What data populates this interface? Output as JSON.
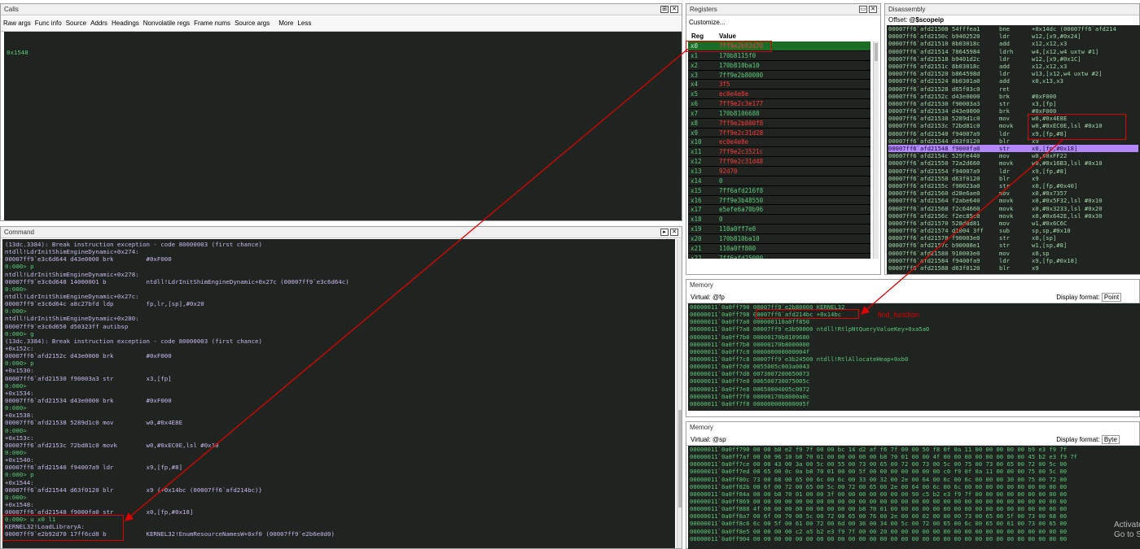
{
  "calls": {
    "title": "Calls",
    "toolbar": [
      "Raw args",
      "Func info",
      "Source",
      "Addrs",
      "Headings",
      "Nonvolatile regs",
      "Frame nums",
      "Source args",
      "More",
      "Less"
    ],
    "content": "0x1548"
  },
  "command": {
    "title": "Command",
    "lines": [
      {
        "t": "(13dc.3384): Break instruction exception - code 80000003 (first chance)",
        "c": "c-lav"
      },
      {
        "t": "ntdll!LdrInitShimEngineDynamic+0x274:",
        "c": "c-lav"
      },
      {
        "t": "00007ff9`e3c6d644 d43e0000 brk         #0xF000",
        "c": "c-lav"
      },
      {
        "t": "0:000> p",
        "c": "c-grn"
      },
      {
        "t": "ntdll!LdrInitShimEngineDynamic+0x278:",
        "c": "c-lav"
      },
      {
        "t": "00007ff9`e3c6d648 14000001 b           ntdll!LdrInitShimEngineDynamic+0x27c (00007ff9`e3c6d64c)",
        "c": "c-lav"
      },
      {
        "t": "0:000>",
        "c": "c-grn"
      },
      {
        "t": "ntdll!LdrInitShimEngineDynamic+0x27c:",
        "c": "c-lav"
      },
      {
        "t": "00007ff9`e3c6d64c a8c27bfd ldp         fp,lr,[sp],#0x20",
        "c": "c-lav"
      },
      {
        "t": "0:000>",
        "c": "c-grn"
      },
      {
        "t": "ntdll!LdrInitShimEngineDynamic+0x280:",
        "c": "c-lav"
      },
      {
        "t": "00007ff9`e3c6d650 d50323ff autibsp",
        "c": "c-lav"
      },
      {
        "t": "0:000> g",
        "c": "c-grn"
      },
      {
        "t": "(13dc.3384): Break instruction exception - code 80000003 (first chance)",
        "c": "c-lav"
      },
      {
        "t": "+0x152c:",
        "c": "c-lav"
      },
      {
        "t": "00007ff6`afd2152c d43e0000 brk         #0xF000",
        "c": "c-lav"
      },
      {
        "t": "0:000> p",
        "c": "c-grn"
      },
      {
        "t": "+0x1530:",
        "c": "c-lav"
      },
      {
        "t": "00007ff6`afd21530 f90003a3 str         x3,[fp]",
        "c": "c-lav"
      },
      {
        "t": "0:000>",
        "c": "c-grn"
      },
      {
        "t": "+0x1534:",
        "c": "c-lav"
      },
      {
        "t": "00007ff6`afd21534 d43e0000 brk         #0xF000",
        "c": "c-lav"
      },
      {
        "t": "0:000>",
        "c": "c-grn"
      },
      {
        "t": "+0x1538:",
        "c": "c-lav"
      },
      {
        "t": "00007ff6`afd21538 5289d1c0 mov         w0,#0x4E8E",
        "c": "c-lav"
      },
      {
        "t": "0:000>",
        "c": "c-grn"
      },
      {
        "t": "+0x153c:",
        "c": "c-lav"
      },
      {
        "t": "00007ff6`afd2153c 72bd81c0 movk        w0,#0xEC0E,lsl #0x10",
        "c": "c-lav"
      },
      {
        "t": "0:000>",
        "c": "c-grn"
      },
      {
        "t": "+0x1540:",
        "c": "c-lav"
      },
      {
        "t": "00007ff6`afd21540 f94007a9 ldr         x9,[fp,#8]",
        "c": "c-lav"
      },
      {
        "t": "0:000> p",
        "c": "c-grn"
      },
      {
        "t": "+0x1544:",
        "c": "c-lav"
      },
      {
        "t": "00007ff6`afd21544 d63f0120 blr         x9 {+0x14bc (00007ff6`afd214bc)}",
        "c": "c-lav"
      },
      {
        "t": "0:000>",
        "c": "c-grn"
      },
      {
        "t": "+0x1548:",
        "c": "c-lav"
      },
      {
        "t": "00007ff6`afd21548 f9000fa0 str         x0,[fp,#0x18]",
        "c": "c-lav"
      },
      {
        "t": "0:000> u x0 l1",
        "c": "c-grn"
      },
      {
        "t": "KERNEL32!LoadLibraryA:",
        "c": "c-lav"
      },
      {
        "t": "00007ff9`e2b92d70 17ff6cd8 b           KERNEL32!EnumResourceNamesW+0xf0 (00007ff9`e2b6e0d0)",
        "c": "c-lav"
      }
    ]
  },
  "registers": {
    "title": "Registers",
    "customize": "Customize...",
    "col_reg": "Reg",
    "col_value": "Value",
    "rows": [
      {
        "r": "x0",
        "v": "7ff9e2b92d70",
        "red": true
      },
      {
        "r": "x1",
        "v": "170b8115f0",
        "red": false
      },
      {
        "r": "x2",
        "v": "170b810ba10",
        "red": false
      },
      {
        "r": "x3",
        "v": "7ff9e2b80000",
        "red": false
      },
      {
        "r": "x4",
        "v": "3f5",
        "red": true
      },
      {
        "r": "x5",
        "v": "ec0e4e8e",
        "red": true
      },
      {
        "r": "x6",
        "v": "7ff9e2c3e177",
        "red": true
      },
      {
        "r": "x7",
        "v": "170b8106688",
        "red": false
      },
      {
        "r": "x8",
        "v": "7ff9e2b800f8",
        "red": true
      },
      {
        "r": "x9",
        "v": "7ff9e2c31d28",
        "red": true
      },
      {
        "r": "x10",
        "v": "ec0e4e8e",
        "red": true
      },
      {
        "r": "x11",
        "v": "7ff9e2c3521c",
        "red": true
      },
      {
        "r": "x12",
        "v": "7ff9e2c31d48",
        "red": true
      },
      {
        "r": "x13",
        "v": "92d70",
        "red": true
      },
      {
        "r": "x14",
        "v": "0",
        "red": false
      },
      {
        "r": "x15",
        "v": "7ff6afd216f8",
        "red": false
      },
      {
        "r": "x16",
        "v": "7ff9e3b48550",
        "red": false
      },
      {
        "r": "x17",
        "v": "e5efe6a70b96",
        "red": false
      },
      {
        "r": "x18",
        "v": "0",
        "red": false
      },
      {
        "r": "x19",
        "v": "110a0ff7e0",
        "red": false
      },
      {
        "r": "x20",
        "v": "170b810ba10",
        "red": false
      },
      {
        "r": "x21",
        "v": "110a0ff800",
        "red": false
      },
      {
        "r": "x22",
        "v": "7ff6afd25000",
        "red": false
      }
    ]
  },
  "disassembly": {
    "title": "Disassembly",
    "offset_label": "Offset:",
    "offset_value": "@$scopeip",
    "lines": [
      {
        "a": "00007ff6`afd21508 54fffea1",
        "m": "bne",
        "o": "+0x14dc (00007ff6`afd214"
      },
      {
        "a": "00007ff6`afd2150c b9402520",
        "m": "ldr",
        "o": "w12,[x9,#0x24]"
      },
      {
        "a": "00007ff6`afd21510 8b03018c",
        "m": "add",
        "o": "x12,x12,x3"
      },
      {
        "a": "00007ff6`afd21514 78645984",
        "m": "ldrh",
        "o": "w4,[x12,w4 uxtw #1]"
      },
      {
        "a": "00007ff6`afd21518 b9401d2c",
        "m": "ldr",
        "o": "w12,[x9,#0x1C]"
      },
      {
        "a": "00007ff6`afd2151c 8b03018c",
        "m": "add",
        "o": "x12,x12,x3"
      },
      {
        "a": "00007ff6`afd21520 b864598d",
        "m": "ldr",
        "o": "w13,[x12,w4 uxtw #2]"
      },
      {
        "a": "00007ff6`afd21524 8b0301a0",
        "m": "add",
        "o": "x0,x13,x3"
      },
      {
        "a": "00007ff6`afd21528 d65f03c0",
        "m": "ret",
        "o": ""
      },
      {
        "a": "00007ff6`afd2152c d43e0000",
        "m": "brk",
        "o": "#0xF000"
      },
      {
        "a": "00007ff6`afd21530 f90003a3",
        "m": "str",
        "o": "x3,[fp]"
      },
      {
        "a": "00007ff6`afd21534 d43e0000",
        "m": "brk",
        "o": "#0xF000"
      },
      {
        "a": "00007ff6`afd21538 5289d1c0",
        "m": "mov",
        "o": "w0,#0x4E8E"
      },
      {
        "a": "00007ff6`afd2153c 72bd81c0",
        "m": "movk",
        "o": "w0,#0xEC0E,lsl #0x10"
      },
      {
        "a": "00007ff6`afd21540 f94007a9",
        "m": "ldr",
        "o": "x9,[fp,#8]"
      },
      {
        "a": "00007ff6`afd21544 d63f0120",
        "m": "blr",
        "o": "x9"
      },
      {
        "a": "00007ff6`afd21548 f9000fa0",
        "m": "str",
        "o": "x0,[fp,#0x18]",
        "hl": true
      },
      {
        "a": "00007ff6`afd2154c 529fe440",
        "m": "mov",
        "o": "w0,#0xFF22"
      },
      {
        "a": "00007ff6`afd21550 72a2d660",
        "m": "movk",
        "o": "w0,#0x16B3,lsl #0x10"
      },
      {
        "a": "00007ff6`afd21554 f94007a9",
        "m": "ldr",
        "o": "x9,[fp,#8]"
      },
      {
        "a": "00007ff6`afd21558 d63f0120",
        "m": "blr",
        "o": "x9"
      },
      {
        "a": "00007ff6`afd2155c f90023a0",
        "m": "str",
        "o": "x0,[fp,#0x40]"
      },
      {
        "a": "00007ff6`afd21560 d28e6ae0",
        "m": "mov",
        "o": "x0,#0x7357"
      },
      {
        "a": "00007ff6`afd21564 f2abe640",
        "m": "movk",
        "o": "x0,#0x5F32,lsl #0x10"
      },
      {
        "a": "00007ff6`afd21568 f2c64660",
        "m": "movk",
        "o": "x0,#0x3233,lsl #0x20"
      },
      {
        "a": "00007ff6`afd2156c f2ec85c0",
        "m": "movk",
        "o": "x0,#0x642E,lsl #0x30"
      },
      {
        "a": "00007ff6`afd21570 528d8d81",
        "m": "mov",
        "o": "w1,#0x6C6C"
      },
      {
        "a": "00007ff6`afd21574 d1004 3ff",
        "m": "sub",
        "o": "sp,sp,#0x10"
      },
      {
        "a": "00007ff6`afd21578 f90003e0",
        "m": "str",
        "o": "x0,[sp]"
      },
      {
        "a": "00007ff6`afd2157c b90008e1",
        "m": "str",
        "o": "w1,[sp,#8]"
      },
      {
        "a": "00007ff6`afd21580 910003e0",
        "m": "mov",
        "o": "x0,sp"
      },
      {
        "a": "00007ff6`afd21584 f9400fa9",
        "m": "ldr",
        "o": "x9,[fp,#0x18]"
      },
      {
        "a": "00007ff6`afd21588 d63f0120",
        "m": "blr",
        "o": "x9"
      }
    ]
  },
  "memory1": {
    "title": "Memory",
    "virtual_label": "Virtual:",
    "virtual_value": "@fp",
    "display_label": "Display format:",
    "display_value": "Point",
    "lines": [
      {
        "a": "00000011`0a0ff790",
        "v": "00007ff9`e2b80000 KERNEL32"
      },
      {
        "a": "00000011`0a0ff798",
        "v": "00007ff6`afd214bc +0x14bc"
      },
      {
        "a": "00000011`0a0ff7a0",
        "v": "000000110a0ff850"
      },
      {
        "a": "00000011`0a0ff7a8",
        "v": "00007ff9`e3b90000 ntdll!RtlpNtQueryValueKey+0xa5a0"
      },
      {
        "a": "00000011`0a0ff7b0",
        "v": "00000170b8109680"
      },
      {
        "a": "00000011`0a0ff7b8",
        "v": "00000170b8000000"
      },
      {
        "a": "00000011`0a0ff7c0",
        "v": "000000000000004f"
      },
      {
        "a": "00000011`0a0ff7c8",
        "v": "00007ff9`e3b24500 ntdll!RtlAllocateHeap+0xb0"
      },
      {
        "a": "00000011`0a0ff7d0",
        "v": "0055005c003a0043"
      },
      {
        "a": "00000011`0a0ff7d8",
        "v": "0073007200650073"
      },
      {
        "a": "00000011`0a0ff7e0",
        "v": "006500730075005c"
      },
      {
        "a": "00000011`0a0ff7e8",
        "v": "00650004005c0072"
      },
      {
        "a": "00000011`0a0ff7f0",
        "v": "00000170b8000a0c"
      },
      {
        "a": "00000011`0a0ff7f8",
        "v": "000000000000005f"
      }
    ]
  },
  "memory2": {
    "title": "Memory",
    "virtual_label": "Virtual:",
    "virtual_value": "@sp",
    "display_label": "Display format:",
    "display_value": "Byte",
    "lines": [
      {
        "a": "00000011`0a0ff790",
        "v": "00 00 b8 e2 f9 7f 00 00 bc 14 d2 af f6 7f 00 00 50 f8 0f 0a 11 00 00 00 00 00 b9 e3 f9 7f"
      },
      {
        "a": "00000011`0a0ff7af",
        "v": "00 00 96 10 b8 70 01 00 00 00 00 00 b8 70 01 00 00 4f 00 00 00 00 00 00 00 00 45 b2 e3 f9 7f"
      },
      {
        "a": "00000011`0a0ff7ce",
        "v": "00 00 43 00 3a 00 5c 00 55 00 73 00 65 00 72 00 73 00 5c 00 75 00 73 00 65 00 72 00 5c 00"
      },
      {
        "a": "00000011`0a0ff7ed",
        "v": "00 65 00 0c 0a b8 70 01 00 00 5f 00 00 00 00 00 00 00 c0 f9 0f 0a 11 00 00 00 75 00 5c 00"
      },
      {
        "a": "00000011`0a0ff80c",
        "v": "73 00 68 00 65 00 6c 00 6c 00 33 00 32 00 2e 00 64 00 6c 00 6c 00 00 00 30 00 75 00 72 00"
      },
      {
        "a": "00000011`0a0ff82b",
        "v": "00 6f 00 72 00 65 00 5c 00 72 00 65 00 2e 00 64 00 6c 00 6c 00 00 00 00 00 00 00 00 00 00"
      },
      {
        "a": "00000011`0a0ff84a",
        "v": "00 00 b8 70 01 00 00 3f 00 00 00 00 00 00 00 90 c5 b2 e3 f9 7f 00 00 00 00 00 00 00 00 00"
      },
      {
        "a": "00000011`0a0ff869",
        "v": "00 00 00 00 00 00 00 00 00 00 00 00 00 00 00 00 00 00 00 00 00 00 00 00 00 00 00 00 00 00"
      },
      {
        "a": "00000011`0a0ff888",
        "v": "4f 00 00 00 00 00 00 00 00 00 b8 70 01 00 00 00 00 00 00 00 00 00 00 00 00 00 00 00 00 00"
      },
      {
        "a": "00000011`0a0ff8a7",
        "v": "00 6f 00 70 00 5c 00 72 00 65 00 76 00 2e 00 00 02 00 00 00 73 00 65 00 5f 00 73 00 68 00"
      },
      {
        "a": "00000011`0a0ff8c6",
        "v": "6c 00 5f 00 61 00 72 00 6d 00 36 00 34 00 5c 00 72 00 65 00 6c 00 65 00 61 00 73 00 65 00"
      },
      {
        "a": "00000011`0a0ff8e5",
        "v": "00 00 00 00 c2 a5 b2 e3 f9 7f 00 00 20 00 00 00 00 00 00 00 00 00 00 00 00 00 00 00 00 00"
      },
      {
        "a": "00000011`0a0ff904",
        "v": "00 00 00 00 00 00 00 00 00 00 00 00 00 00 00 00 00 00 00 00 00 00 00 00 00 00 00 00 00 00"
      }
    ]
  },
  "annotation": "find_function",
  "watermark": "Activate\nGo to Setti"
}
